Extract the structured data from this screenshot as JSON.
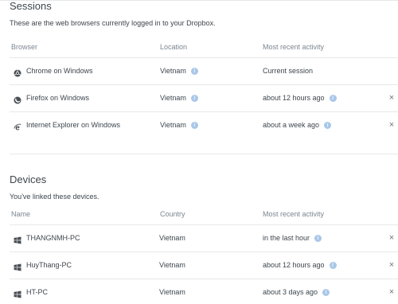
{
  "sessions": {
    "title": "Sessions",
    "description": "These are the web browsers currently logged in to your Dropbox.",
    "headers": {
      "browser": "Browser",
      "location": "Location",
      "activity": "Most recent activity"
    },
    "rows": [
      {
        "browser": "Chrome on Windows",
        "icon": "chrome-icon",
        "location": "Vietnam",
        "activity": "Current session",
        "closable": false
      },
      {
        "browser": "Firefox on Windows",
        "icon": "firefox-icon",
        "location": "Vietnam",
        "activity": "about 12 hours ago",
        "closable": true
      },
      {
        "browser": "Internet Explorer on Windows",
        "icon": "internet-explorer-icon",
        "location": "Vietnam",
        "activity": "about a week ago",
        "closable": true
      }
    ]
  },
  "devices": {
    "title": "Devices",
    "description": "You've linked these devices.",
    "headers": {
      "name": "Name",
      "country": "Country",
      "activity": "Most recent activity"
    },
    "rows": [
      {
        "name": "THANGNMH-PC",
        "icon": "windows-icon",
        "country": "Vietnam",
        "activity": "in the last hour",
        "closable": true
      },
      {
        "name": "HuyThang-PC",
        "icon": "windows-icon",
        "country": "Vietnam",
        "activity": "about 12 hours ago",
        "closable": true
      },
      {
        "name": "HT-PC",
        "icon": "windows-icon",
        "country": "Vietnam",
        "activity": "about 3 days ago",
        "closable": true
      }
    ]
  },
  "glyphs": {
    "info": "i",
    "close": "×"
  },
  "colors": {
    "info_badge": "#a9c7e8",
    "text": "#3d464d",
    "muted": "#7b868f",
    "divider": "#e6e8ea"
  }
}
